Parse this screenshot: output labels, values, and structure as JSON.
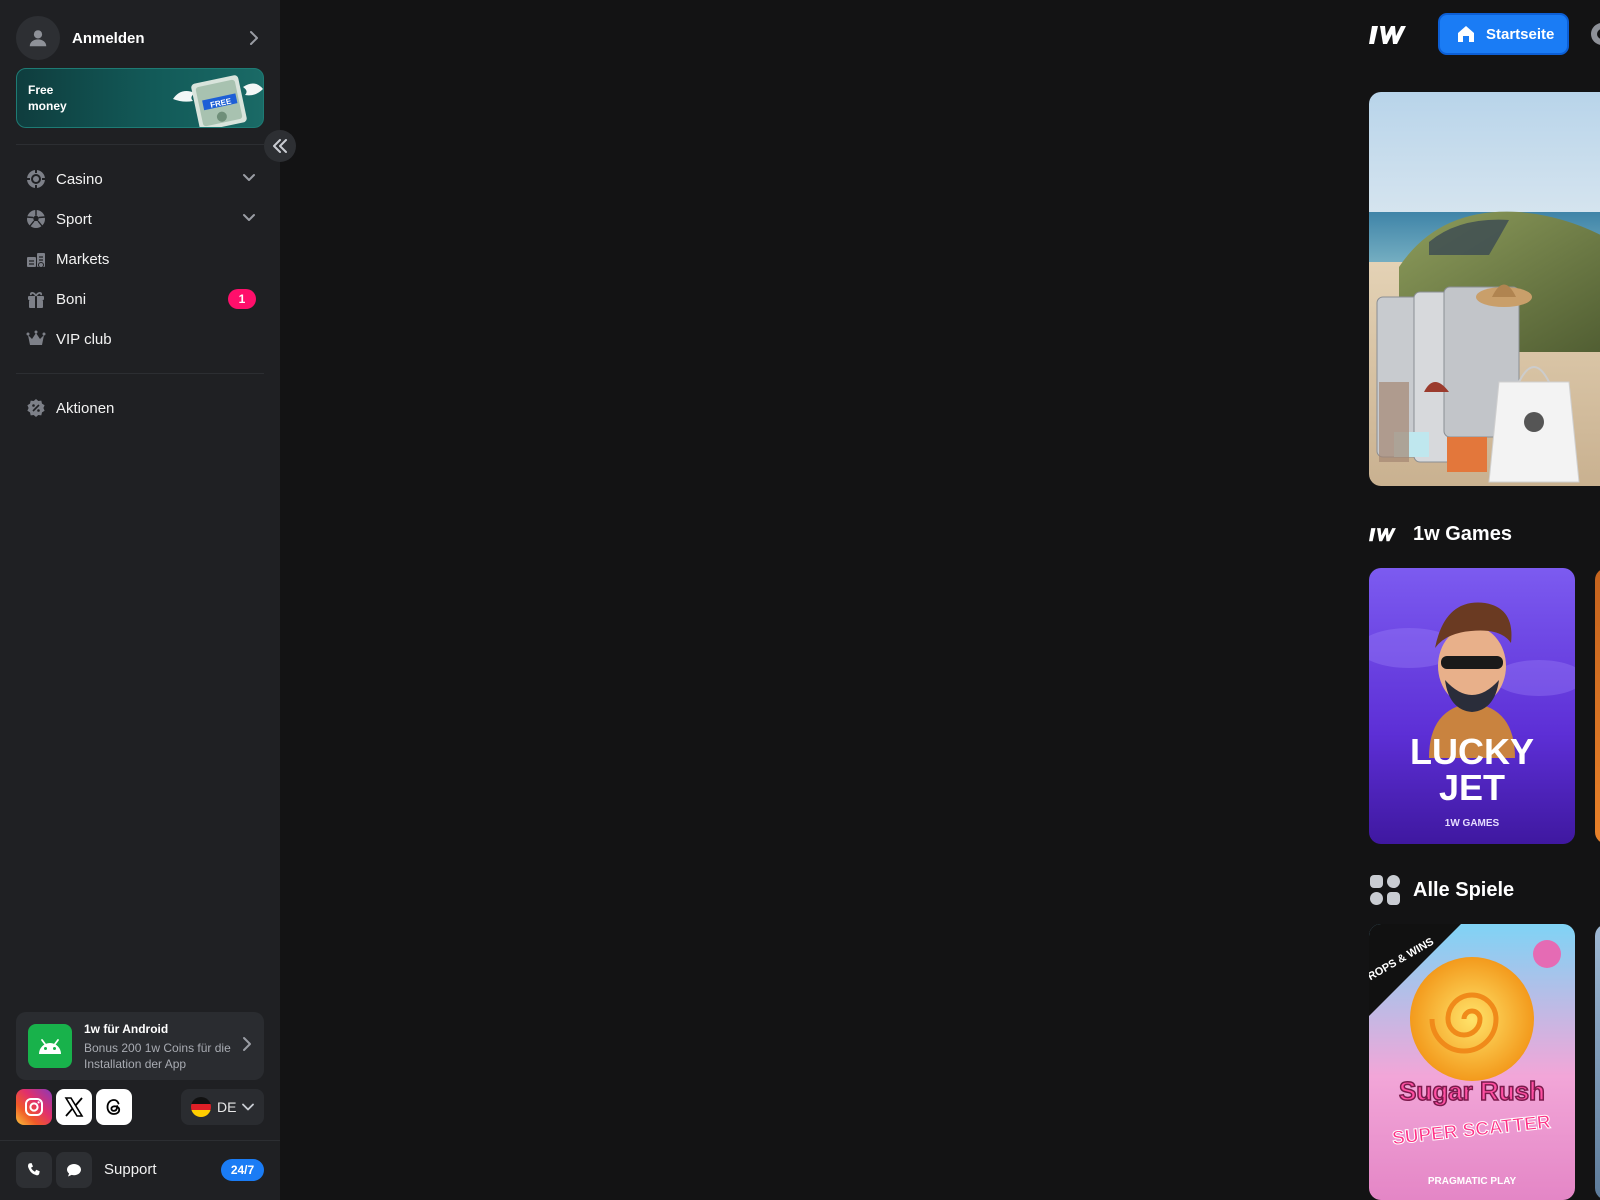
{
  "sidebar": {
    "login_label": "Anmelden",
    "promo_label": "Free money",
    "promo_art_text": "FREE",
    "nav": [
      {
        "label": "Casino",
        "icon": "casino-chip-icon"
      },
      {
        "label": "Sport",
        "icon": "soccer-ball-icon"
      },
      {
        "label": "Markets",
        "icon": "markets-icon"
      },
      {
        "label": "Boni",
        "icon": "gift-icon",
        "badge": "1"
      },
      {
        "label": "VIP club",
        "icon": "crown-icon"
      }
    ],
    "secondary_nav": [
      {
        "label": "Aktionen",
        "icon": "percent-badge-icon"
      }
    ],
    "app_card": {
      "title": "1w für Android",
      "subtitle": "Bonus 200 1w Coins für die Installation der App"
    },
    "language": "DE",
    "support_label": "Support",
    "support_badge": "24/7"
  },
  "header": {
    "home_label": "Startseite"
  },
  "sections": {
    "games_1w": {
      "title": "1w Games",
      "card": {
        "title_line1": "LUCKY",
        "title_line2": "JET",
        "provider": "1W GAMES"
      }
    },
    "all_games": {
      "title": "Alle Spiele",
      "card": {
        "badge": "DROPS & WINS",
        "title_line1": "Sugar Rush",
        "title_line2": "SUPER SCATTER",
        "provider": "PRAGMATIC PLAY"
      }
    }
  },
  "colors": {
    "accent": "#1a7cf5",
    "badge": "#ff0f6b",
    "android": "#18b24b",
    "sidebar": "#1f2023",
    "background": "#131314"
  }
}
